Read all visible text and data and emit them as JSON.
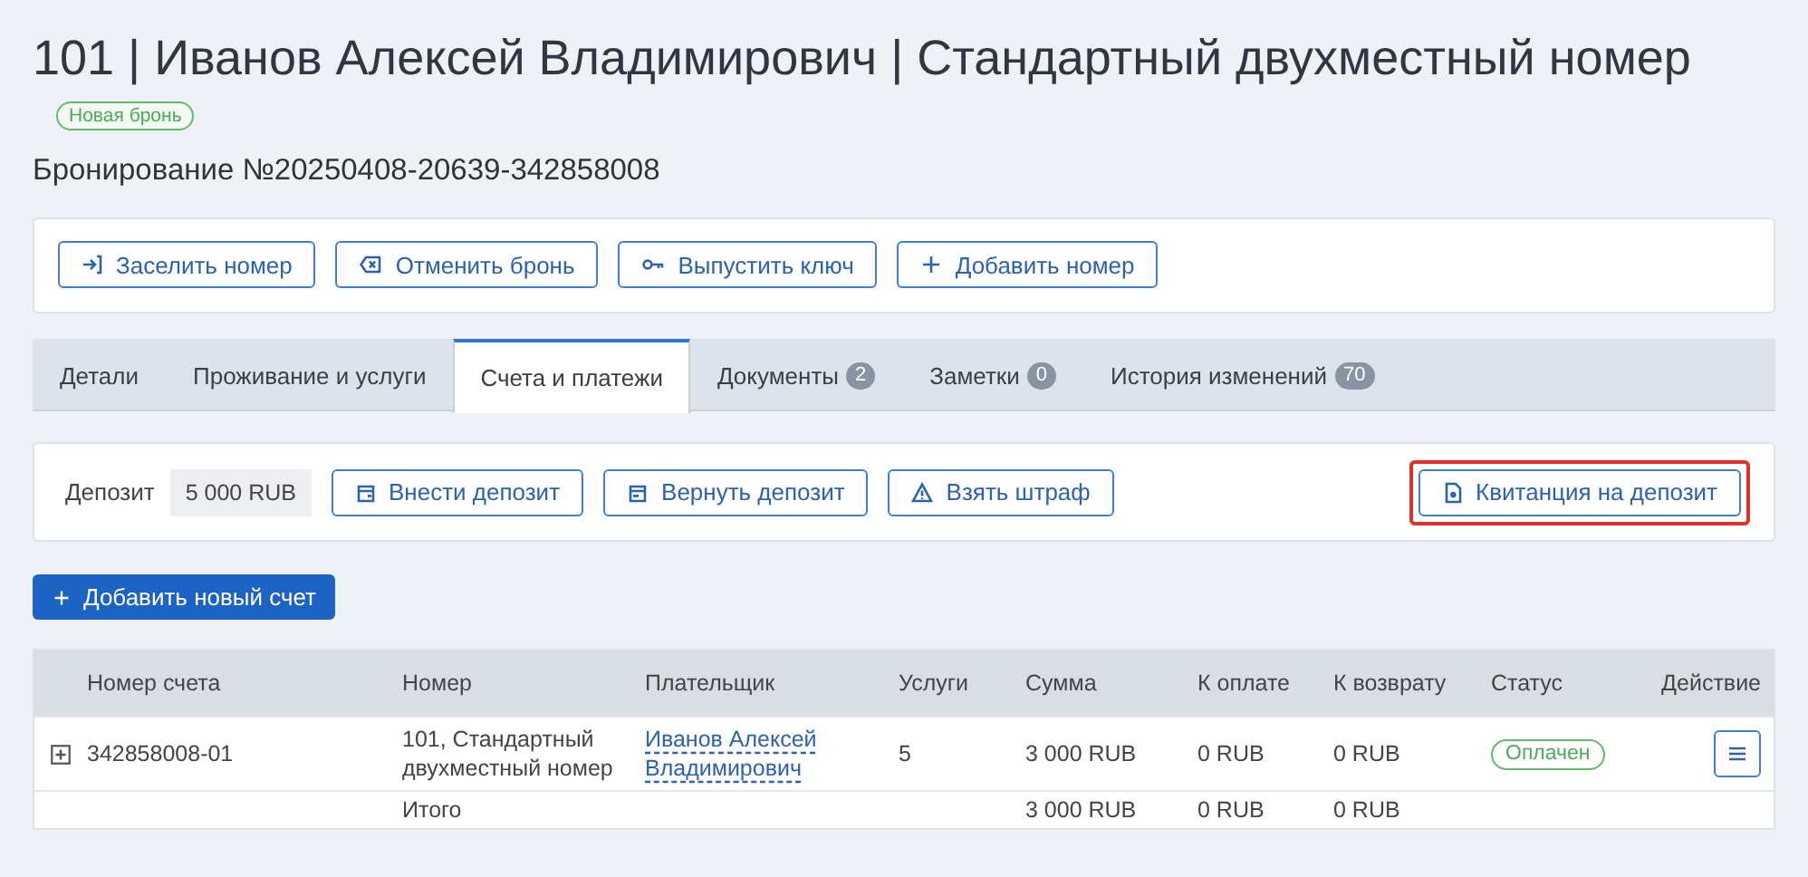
{
  "title": "101 | Иванов Алексей Владимирович | Стандартный двухместный номер",
  "status_badge": "Новая бронь",
  "booking_number": "Бронирование №20250408-20639-342858008",
  "actions": [
    {
      "kind": "check-in",
      "label": "Заселить номер"
    },
    {
      "kind": "cancel",
      "label": "Отменить бронь"
    },
    {
      "kind": "key",
      "label": "Выпустить ключ"
    },
    {
      "kind": "add",
      "label": "Добавить номер"
    }
  ],
  "tabs": [
    {
      "label": "Детали",
      "selected": false
    },
    {
      "label": "Проживание и услуги",
      "selected": false
    },
    {
      "label": "Счета и платежи",
      "selected": true
    },
    {
      "label": "Документы",
      "count": "2",
      "selected": false
    },
    {
      "label": "Заметки",
      "count": "0",
      "selected": false
    },
    {
      "label": "История изменений",
      "count": "70",
      "selected": false
    }
  ],
  "deposit": {
    "label": "Депозит",
    "amount": "5 000 RUB",
    "buttons": [
      {
        "kind": "deposit-in",
        "label": "Внести депозит"
      },
      {
        "kind": "deposit-out",
        "label": "Вернуть депозит"
      },
      {
        "kind": "fine",
        "label": "Взять штраф"
      }
    ],
    "receipt_button": {
      "label": "Квитанция на депозит",
      "highlighted": true
    }
  },
  "add_invoice_button": "Добавить новый счет",
  "table": {
    "columns": [
      "Номер счета",
      "Номер",
      "Плательщик",
      "Услуги",
      "Сумма",
      "К оплате",
      "К возврату",
      "Статус",
      "Действие"
    ],
    "rows": [
      {
        "expanded": false,
        "account": "342858008-01",
        "room": "101, Стандартный двухместный номер",
        "payer": "Иванов Алексей Владимирович",
        "services": "5",
        "sum": "3 000 RUB",
        "to_pay": "0 RUB",
        "to_refund": "0 RUB",
        "status": "Оплачен"
      }
    ],
    "total": {
      "label": "Итого",
      "sum": "3 000 RUB",
      "to_pay": "0 RUB",
      "to_refund": "0 RUB"
    }
  }
}
